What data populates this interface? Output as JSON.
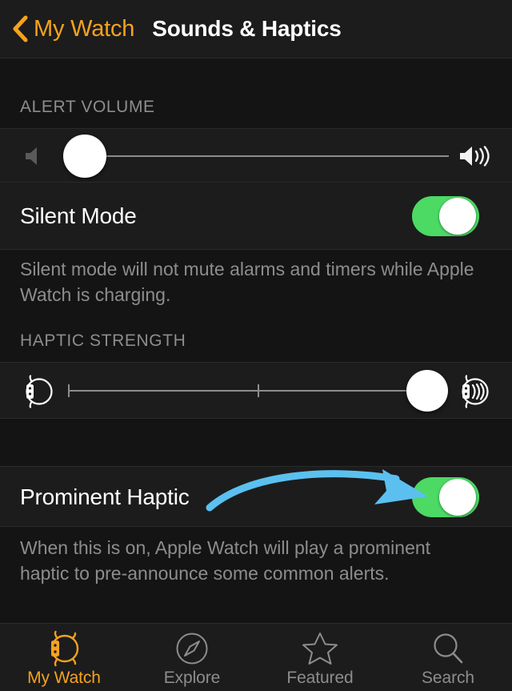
{
  "navbar": {
    "back_label": "My Watch",
    "back_icon": "chevron-left-icon",
    "title": "Sounds & Haptics",
    "accent_color": "#f5a21e"
  },
  "sections": {
    "alert_volume": {
      "header": "ALERT VOLUME",
      "slider": {
        "name": "alert-volume-slider",
        "value_percent": 5,
        "min_icon": "speaker-low-icon",
        "max_icon": "speaker-high-icon"
      }
    },
    "silent_mode": {
      "title": "Silent Mode",
      "toggle_on": true,
      "toggle_color": "#4cd964",
      "footer": "Silent mode will not mute alarms and timers while Apple Watch is charging."
    },
    "haptic_strength": {
      "header": "HAPTIC STRENGTH",
      "slider": {
        "name": "haptic-strength-slider",
        "value_percent": 100,
        "min_icon": "watch-haptic-off-icon",
        "max_icon": "watch-haptic-strong-icon",
        "ticks": 3
      }
    },
    "prominent_haptic": {
      "title": "Prominent Haptic",
      "toggle_on": true,
      "toggle_color": "#4cd964",
      "footer": "When this is on, Apple Watch will play a prominent haptic to pre-announce some common alerts.",
      "annotation": {
        "type": "curved-arrow",
        "color": "#5bc0f0",
        "points_to": "prominent-haptic-toggle"
      }
    }
  },
  "tabbar": {
    "items": [
      {
        "label": "My Watch",
        "icon": "apple-watch-icon",
        "active": true
      },
      {
        "label": "Explore",
        "icon": "compass-icon",
        "active": false
      },
      {
        "label": "Featured",
        "icon": "star-icon",
        "active": false
      },
      {
        "label": "Search",
        "icon": "magnifier-icon",
        "active": false
      }
    ]
  }
}
